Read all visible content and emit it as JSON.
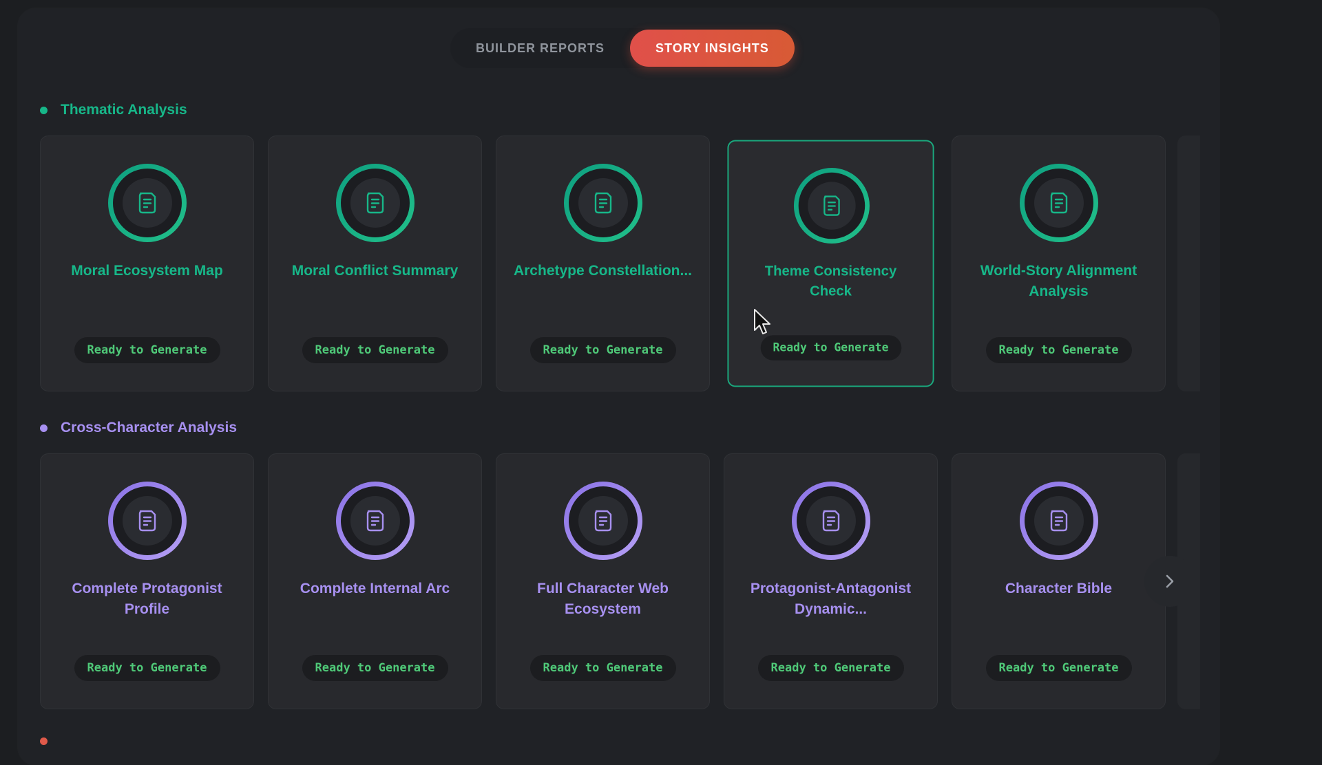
{
  "tabs": [
    {
      "label": "BUILDER REPORTS",
      "active": false
    },
    {
      "label": "STORY INSIGHTS",
      "active": true
    }
  ],
  "colors": {
    "thematic_accent": "#17b789",
    "cross_character_accent": "#a790f0",
    "status_text": "#4fc978",
    "active_tab": "#e0504a"
  },
  "sections": [
    {
      "title": "Thematic Analysis",
      "cards": [
        {
          "title": "Moral Ecosystem Map",
          "status": "Ready to Generate",
          "icon": "document-icon"
        },
        {
          "title": "Moral Conflict Summary",
          "status": "Ready to Generate",
          "icon": "document-icon"
        },
        {
          "title": "Archetype Constellation...",
          "status": "Ready to Generate",
          "icon": "document-icon"
        },
        {
          "title": "Theme Consistency Check",
          "status": "Ready to Generate",
          "icon": "document-icon"
        },
        {
          "title": "World-Story Alignment Analysis",
          "status": "Ready to Generate",
          "icon": "document-icon"
        }
      ]
    },
    {
      "title": "Cross-Character Analysis",
      "cards": [
        {
          "title": "Complete Protagonist Profile",
          "status": "Ready to Generate",
          "icon": "document-icon"
        },
        {
          "title": "Complete Internal Arc",
          "status": "Ready to Generate",
          "icon": "document-icon"
        },
        {
          "title": "Full Character Web Ecosystem",
          "status": "Ready to Generate",
          "icon": "document-icon"
        },
        {
          "title": "Protagonist-Antagonist Dynamic...",
          "status": "Ready to Generate",
          "icon": "document-icon"
        },
        {
          "title": "Character Bible",
          "status": "Ready to Generate",
          "icon": "document-icon"
        }
      ]
    }
  ],
  "next_icon": "chevron-right-icon"
}
